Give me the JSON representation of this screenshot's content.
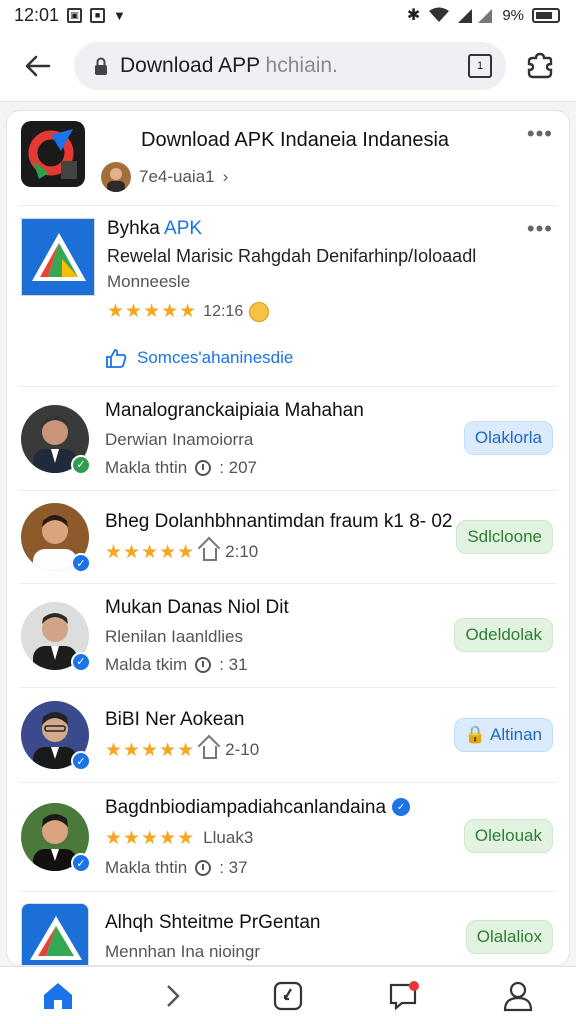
{
  "status_bar": {
    "time": "12:01",
    "battery": "9%",
    "icons": [
      "screenshot-icon",
      "notification-icon",
      "dropdown-icon",
      "bluetooth-icon",
      "wifi-icon",
      "signal-icon"
    ]
  },
  "browser": {
    "url_host": "Download APP",
    "url_rest": " hchiain.",
    "tab_count": "1"
  },
  "feed": {
    "header": {
      "title": "Download APK Indaneia Indanesia",
      "subtitle": "7e4-uaia1"
    },
    "sponsored": {
      "name_prefix": "Byhka ",
      "name_accent": "APK",
      "description": "Rewelal Marisic Rahgdah Denifarhinp/Ioloaadl",
      "category": "Monneesle",
      "stars": "★★★★★",
      "rating": "12:16",
      "like_text": "Somces'ahaninesdie"
    },
    "items": [
      {
        "name": "Manalogranckaipiaia Mahahan",
        "line2": "Derwian Inamoiorra",
        "line3": "Makla thtin",
        "count": ": 207",
        "action": "Olaklorla",
        "action_style": "blue",
        "badge_color": "#2e9d4c"
      },
      {
        "name": "Bheg Dolanhbhnantimdan fraum k1 8- 02",
        "stars": "★★★★★",
        "count": "2:10",
        "action": "Sdlcloone",
        "action_style": "green",
        "badge_color": "#1a73e8"
      },
      {
        "name": "Mukan Danas Niol Dit",
        "line2": "Rlenilan Iaanldlies",
        "line3": "Malda tkim",
        "count": ": 31",
        "action": "Odeldolak",
        "action_style": "green",
        "badge_color": "#1a73e8"
      },
      {
        "name": "BiBI Ner Aokean",
        "stars": "★★★★★",
        "count": "2-10",
        "action": "Altinan",
        "action_style": "blue",
        "badge_color": "#1a73e8"
      },
      {
        "name": "Bagdnbiodiampadiahcanlandaina",
        "stars": "★★★★★",
        "extra": "Lluak3",
        "line3": "Makla thtin",
        "count": ": 37",
        "action": "Olelouak",
        "action_style": "green",
        "badge_color": "#1a73e8"
      },
      {
        "name": "Alhqh Shteitme PrGentan",
        "line2": "Mennhan Ina nioingr",
        "action": "Olalaliox",
        "action_style": "green"
      }
    ]
  },
  "colors": {
    "accent": "#1a73e8",
    "star": "#f6a623",
    "green_pill_bg": "#e2f3e1",
    "blue_pill_bg": "#dcebfb"
  }
}
